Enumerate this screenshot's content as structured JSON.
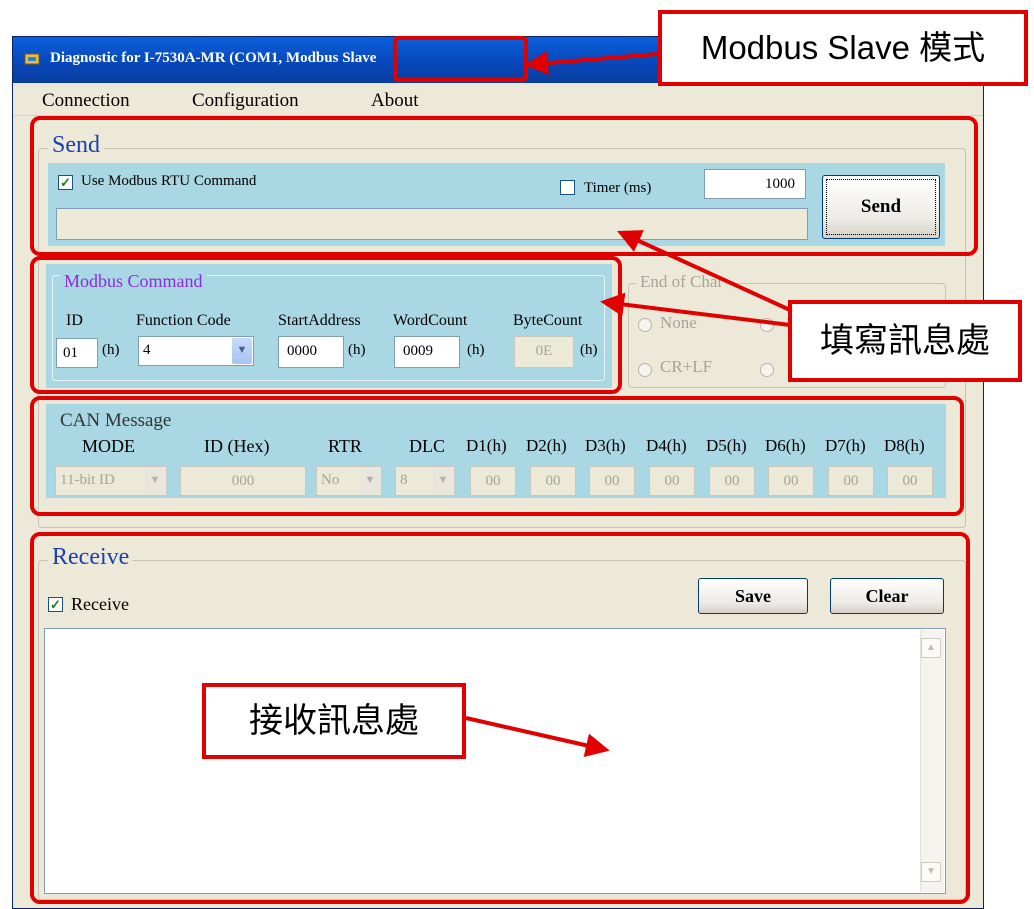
{
  "window": {
    "title": "Diagnostic for I-7530A-MR (COM1, Modbus Slave"
  },
  "menu": [
    "Connection",
    "Configuration",
    "About"
  ],
  "send": {
    "group_label": "Send",
    "use_rtu_label": "Use Modbus RTU Command",
    "use_rtu_checked": true,
    "timer_label": "Timer (ms)",
    "timer_checked": false,
    "timer_value": "1000",
    "send_button": "Send",
    "command_value": ""
  },
  "modbus": {
    "group_label": "Modbus Command",
    "id_label": "ID",
    "id_value": "01",
    "function_label": "Function Code",
    "function_value": "4",
    "start_label": "StartAddress",
    "start_value": "0000",
    "word_label": "WordCount",
    "word_value": "0009",
    "byte_label": "ByteCount",
    "byte_value": "0E",
    "hex_suffix": "(h)"
  },
  "end_of_char": {
    "group_label": "End of Char",
    "none_label": "None",
    "crlf_label": "CR+LF"
  },
  "can": {
    "group_label": "CAN Message",
    "mode_label": "MODE",
    "mode_value": "11-bit ID",
    "id_label": "ID (Hex)",
    "id_value": "000",
    "rtr_label": "RTR",
    "rtr_value": "No",
    "dlc_label": "DLC",
    "dlc_value": "8",
    "data_labels": [
      "D1(h)",
      "D2(h)",
      "D3(h)",
      "D4(h)",
      "D5(h)",
      "D6(h)",
      "D7(h)",
      "D8(h)"
    ],
    "data_values": [
      "00",
      "00",
      "00",
      "00",
      "00",
      "00",
      "00",
      "00"
    ]
  },
  "receive": {
    "group_label": "Receive",
    "receive_label": "Receive",
    "receive_checked": true,
    "save_button": "Save",
    "clear_button": "Clear",
    "log_text": ""
  },
  "annotations": {
    "mode_callout": "Modbus Slave 模式",
    "fill_callout": "填寫訊息處",
    "receive_callout": "接收訊息處"
  },
  "colors": {
    "title_bar": "#0846b8",
    "panel_cyan": "#a9d7e3",
    "window_face": "#ece9d8",
    "highlight_red": "#e00000",
    "group_title_blue": "#1c3fb0",
    "modbus_title_purple": "#8a2be2"
  }
}
